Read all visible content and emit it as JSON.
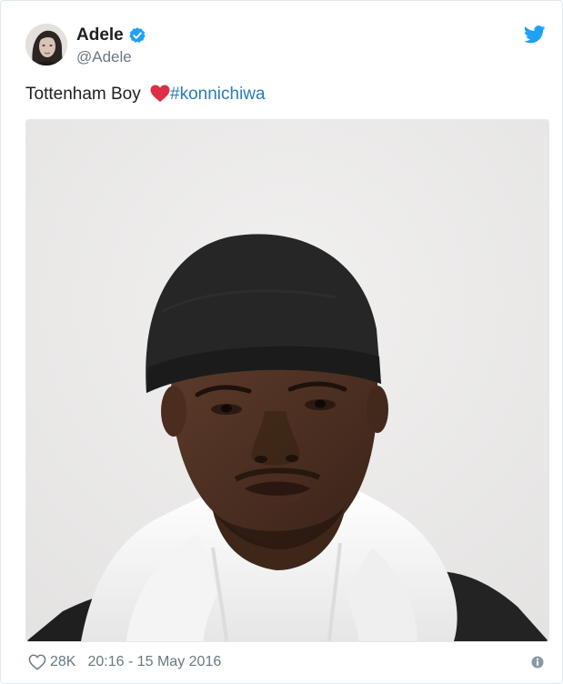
{
  "author": {
    "display_name": "Adele",
    "handle": "@Adele",
    "verified": true
  },
  "tweet": {
    "text_before": "Tottenham Boy ",
    "emoji": "red-heart-emoji",
    "hashtag": "#konnichiwa"
  },
  "footer": {
    "like_count": "28K",
    "timestamp": "20:16 - 15 May 2016"
  },
  "colors": {
    "brand_blue": "#1da1f2",
    "link_blue": "#2b7bb9",
    "muted_text": "#697882",
    "heart_red": "#e0245e"
  },
  "icons": [
    "verified-badge-icon",
    "twitter-bird-icon",
    "heart-outline-icon",
    "info-icon"
  ]
}
